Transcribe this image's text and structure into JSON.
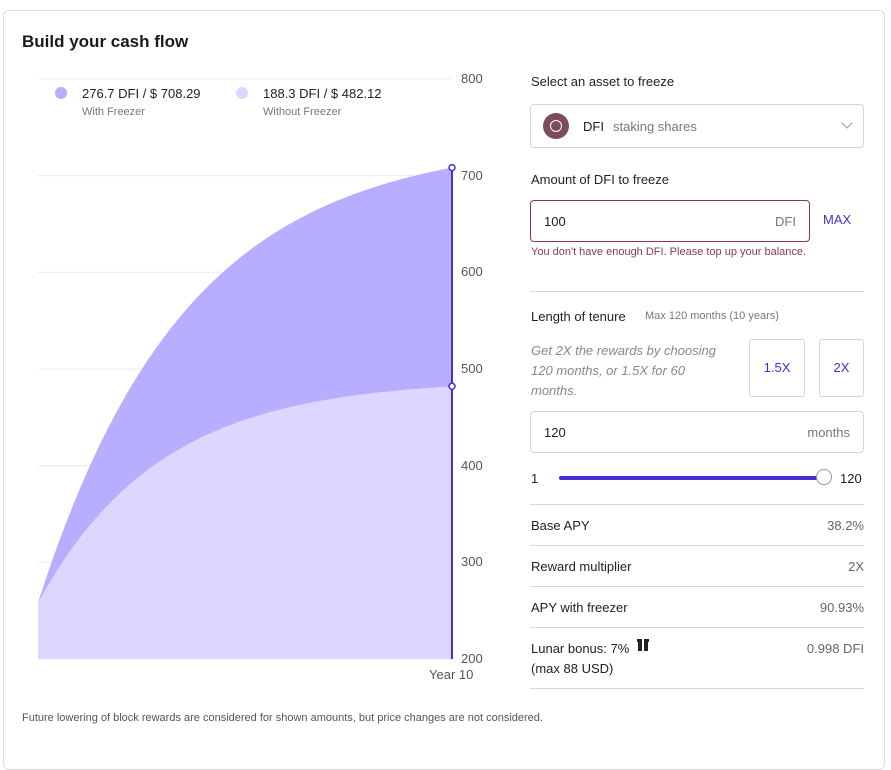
{
  "title": "Build your cash flow",
  "legend": [
    {
      "value": "276.7 DFI / $ 708.29",
      "label": "With Freezer",
      "color": "#b8aeff"
    },
    {
      "value": "188.3 DFI / $ 482.12",
      "label": "Without Freezer",
      "color": "#ddd7ff"
    }
  ],
  "chart_data": {
    "type": "area",
    "x_label_end": "Year 10",
    "ylim": [
      200,
      800
    ],
    "y_ticks": [
      "200",
      "300",
      "400",
      "500",
      "600",
      "700",
      "800"
    ],
    "series": [
      {
        "name": "With Freezer",
        "start": 258,
        "end": 708.29,
        "color": "#b8aeff"
      },
      {
        "name": "Without Freezer",
        "start": 258,
        "end": 482.12,
        "color": "#ddd7ff"
      }
    ],
    "marker_color": "#4b2bd3"
  },
  "asset": {
    "label": "Select an asset to freeze",
    "symbol": "DFI",
    "subtitle": "staking shares"
  },
  "amount": {
    "label": "Amount of DFI to freeze",
    "value": "100",
    "unit": "DFI",
    "max_label": "MAX",
    "error": "You don't have enough DFI. Please top up your balance."
  },
  "tenure": {
    "label": "Length of tenure",
    "note": "Max 120 months (10 years)",
    "hint": "Get 2X the rewards by choosing 120 months, or 1.5X for 60 months.",
    "btn_15x": "1.5X",
    "btn_2x": "2X",
    "value": "120",
    "unit": "months",
    "slider_min": "1",
    "slider_max": "120",
    "slider_value": 120
  },
  "stats": [
    {
      "label": "Base APY",
      "value": "38.2%"
    },
    {
      "label": "Reward multiplier",
      "value": "2X"
    },
    {
      "label": "APY with freezer",
      "value": "90.93%"
    }
  ],
  "bonus": {
    "label": "Lunar bonus: 7%",
    "sublabel": "(max 88 USD)",
    "value": "0.998 DFI",
    "icon": "gift-icon"
  },
  "footnote": "Future lowering of block rewards are considered for shown amounts, but price changes are not considered."
}
